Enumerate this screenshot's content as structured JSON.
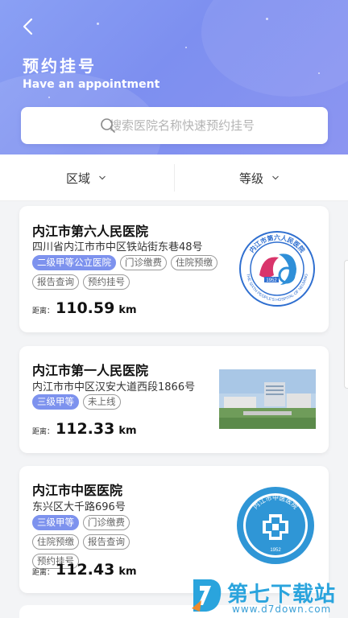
{
  "header": {
    "title_cn": "预约挂号",
    "title_en": "Have an appointment"
  },
  "search": {
    "placeholder": "搜索医院名称快速预约挂号"
  },
  "filters": [
    {
      "label": "区域"
    },
    {
      "label": "等级"
    }
  ],
  "hospitals": [
    {
      "name": "内江市第六人民医院",
      "address": "四川省内江市市中区铁站街东巷48号",
      "tags": [
        {
          "text": "二级甲等公立医院",
          "primary": true
        },
        {
          "text": "门诊缴费",
          "primary": false
        },
        {
          "text": "住院预缴",
          "primary": false
        },
        {
          "text": "报告查询",
          "primary": false
        },
        {
          "text": "预约挂号",
          "primary": false
        }
      ],
      "distance_label": "距离：",
      "distance_value": "110.59",
      "distance_unit": "km",
      "logo_text_top": "内江市第六人民医院",
      "logo_text_bottom": "THE SIXTH PEOPLE'S HOSPITAL OF NEIJIANG",
      "logo_year": "1952"
    },
    {
      "name": "内江市第一人民医院",
      "address": "内江市市中区汉安大道西段1866号",
      "tags": [
        {
          "text": "三级甲等",
          "primary": true
        },
        {
          "text": "未上线",
          "primary": false
        }
      ],
      "distance_label": "距离：",
      "distance_value": "112.33",
      "distance_unit": "km"
    },
    {
      "name": "内江市中医医院",
      "address": "东兴区大千路696号",
      "tags": [
        {
          "text": "三级甲等",
          "primary": true
        },
        {
          "text": "门诊缴费",
          "primary": false
        },
        {
          "text": "住院预缴",
          "primary": false
        },
        {
          "text": "报告查询",
          "primary": false
        },
        {
          "text": "预约挂号",
          "primary": false
        }
      ],
      "distance_label": "距离：",
      "distance_value": "112.43",
      "distance_unit": "km",
      "logo_text_top": "内江市中医医院",
      "logo_year": "1952"
    }
  ],
  "watermark": {
    "name": "第七下载站",
    "url": "www.d7down.com"
  },
  "colors": {
    "header_gradient_start": "#8aa0f4",
    "header_gradient_end": "#8c95f1",
    "primary_tag": "#7d92ee",
    "logo_blue": "#2f8fd8",
    "watermark_blue": "#2aa4dd"
  }
}
